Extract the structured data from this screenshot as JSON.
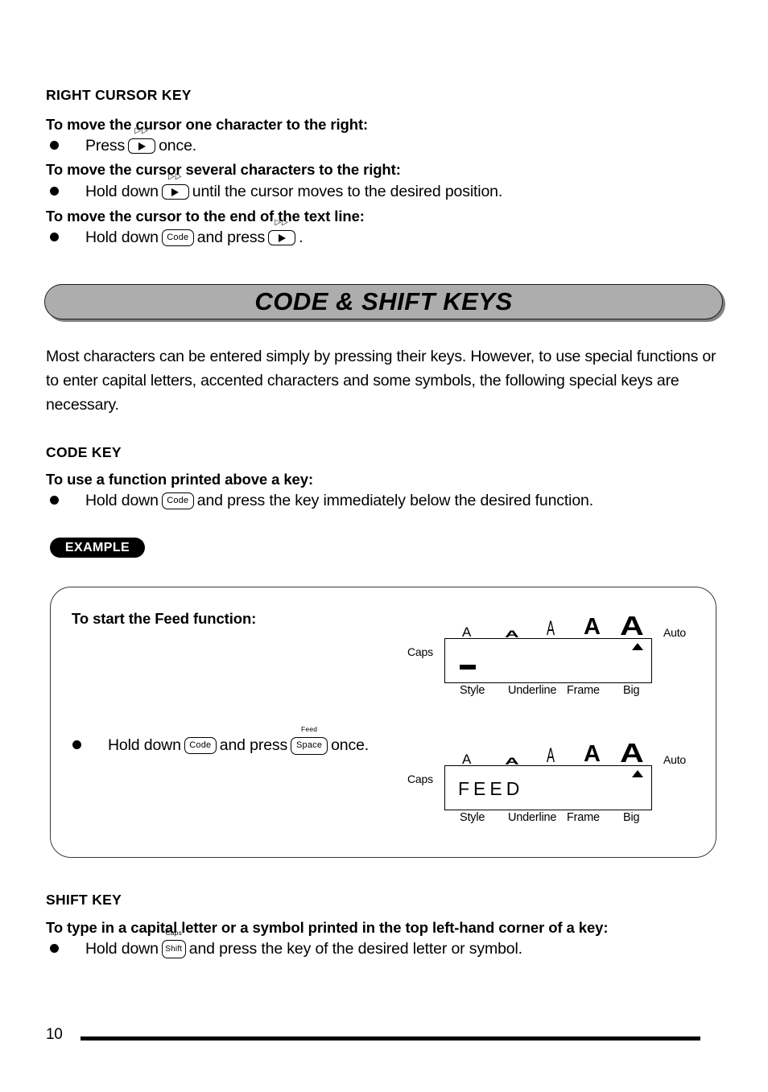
{
  "page": {
    "number": "10"
  },
  "right_cursor_section": {
    "title": "RIGHT CURSOR KEY",
    "items": [
      {
        "heading": "To move the cursor one character to the right:",
        "text_before": "Press",
        "key": {
          "label": "",
          "over": "▷▷",
          "type": "arrow"
        },
        "text_after": "once."
      },
      {
        "heading": "To move the cursor several characters to the right:",
        "text_before": "Hold down",
        "key": {
          "label": "",
          "over": "▷▷",
          "type": "arrow"
        },
        "text_after": "until the cursor moves to the desired position."
      },
      {
        "heading": "To move the cursor to the end of the text line:",
        "text_before": "Hold down",
        "key1": {
          "label": "Code",
          "over": "",
          "type": "code"
        },
        "text_middle": "and press",
        "key2": {
          "label": "",
          "over": "▷▷",
          "type": "arrow"
        },
        "text_after": "."
      }
    ]
  },
  "banner": {
    "title": "CODE & SHIFT KEYS",
    "fill_color": "#adadad",
    "border_color": "#1a1a1a"
  },
  "intro_paragraph": "Most characters can be entered simply by pressing their keys. However, to use special functions or to enter capital letters, accented characters and some symbols, the following special keys are necessary.",
  "code_key_section": {
    "title": "CODE KEY",
    "heading": "To use a function printed above a key:",
    "text_before": "Hold down",
    "key": {
      "label": "Code",
      "over": "",
      "type": "code"
    },
    "text_after": "and press the key immediately below the desired function."
  },
  "example": {
    "badge": "EXAMPLE",
    "badge_bg": "#000000",
    "badge_text_color": "#ffffff",
    "heading": "To start the Feed function:",
    "step": {
      "text_before": "Hold down",
      "key1": {
        "label": "Code",
        "over": "",
        "type": "code"
      },
      "text_middle": "and press",
      "key2": {
        "label": "Space",
        "over": "Feed",
        "type": "space"
      },
      "text_after": "once."
    },
    "display_top": {
      "caps": "Caps",
      "auto": "Auto",
      "screen_text": "",
      "cursor_visible": true,
      "indicators": [
        "A",
        "A",
        "A",
        "A",
        "A"
      ],
      "labels": [
        "Style",
        "Underline",
        "Frame",
        "Big"
      ]
    },
    "display_bottom": {
      "caps": "Caps",
      "auto": "Auto",
      "screen_text": "FEED",
      "cursor_visible": false,
      "indicators": [
        "A",
        "A",
        "A",
        "A",
        "A"
      ],
      "labels": [
        "Style",
        "Underline",
        "Frame",
        "Big"
      ]
    }
  },
  "shift_key_section": {
    "title": "SHIFT KEY",
    "heading": "To type in a capital letter or a symbol printed in the top left-hand corner of a key:",
    "text_before": "Hold down",
    "key": {
      "label": "Shift",
      "over": "Caps",
      "type": "shift"
    },
    "text_after": "and press the key of the desired letter or symbol."
  }
}
